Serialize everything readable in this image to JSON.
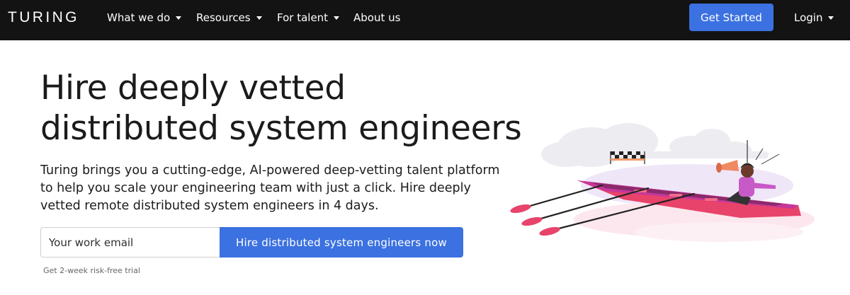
{
  "navbar": {
    "logo": "TURING",
    "items": [
      {
        "label": "What we do",
        "has_dropdown": true
      },
      {
        "label": "Resources",
        "has_dropdown": true
      },
      {
        "label": "For talent",
        "has_dropdown": true
      },
      {
        "label": "About us",
        "has_dropdown": false
      }
    ],
    "cta_label": "Get Started",
    "login_label": "Login"
  },
  "hero": {
    "headline_line1": "Hire deeply vetted",
    "headline_line2": "distributed system engineers",
    "subtext": "Turing brings you a cutting-edge, AI-powered deep-vetting talent platform to help you scale your engineering team with just a click. Hire deeply vetted remote distributed system engineers in 4 days.",
    "email_placeholder": "Your work email",
    "submit_label": "Hire distributed system engineers now",
    "trial_note": "Get 2-week risk-free trial"
  },
  "illustration": {
    "icon": "rowing-boat-illustration"
  },
  "colors": {
    "nav_bg": "#131313",
    "accent": "#3b71e0",
    "boat": "#e8436a",
    "shirt": "#c85ac8"
  }
}
